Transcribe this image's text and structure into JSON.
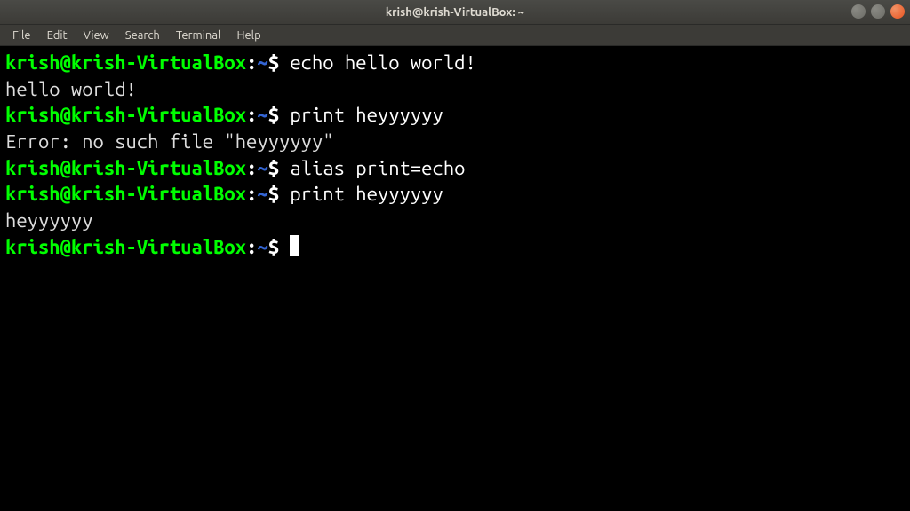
{
  "window": {
    "title": "krish@krish-VirtualBox: ~"
  },
  "menubar": {
    "items": [
      "File",
      "Edit",
      "View",
      "Search",
      "Terminal",
      "Help"
    ]
  },
  "prompt": {
    "user_host": "krish@krish-VirtualBox",
    "colon": ":",
    "path": "~",
    "dollar": "$"
  },
  "lines": [
    {
      "type": "cmd",
      "text": "echo hello world!"
    },
    {
      "type": "out",
      "text": "hello world!"
    },
    {
      "type": "cmd",
      "text": "print heyyyyyy"
    },
    {
      "type": "out",
      "text": "Error: no such file \"heyyyyyy\""
    },
    {
      "type": "cmd",
      "text": "alias print=echo"
    },
    {
      "type": "cmd",
      "text": "print heyyyyyy"
    },
    {
      "type": "out",
      "text": "heyyyyyy"
    },
    {
      "type": "prompt_only"
    }
  ]
}
